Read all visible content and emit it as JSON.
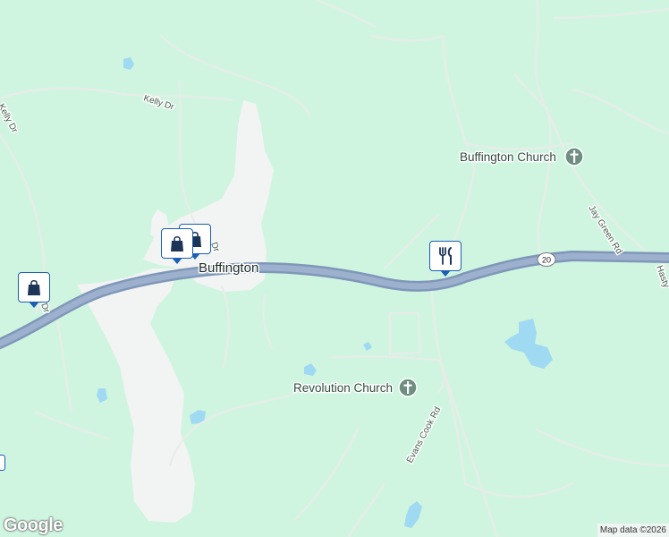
{
  "map": {
    "colors": {
      "land": "#cff5e0",
      "urban": "#f2f3f3",
      "water": "#9fd9f2",
      "highway": "#8fa7c7",
      "minor_road": "#e8ece9",
      "pin_border": "#1a5fb4",
      "pin_icon": "#1d3557"
    },
    "town": "Buffington",
    "places": [
      {
        "label": "Buffington Church",
        "icon": "church-icon"
      },
      {
        "label": "Revolution Church",
        "icon": "church-icon"
      }
    ],
    "roads": {
      "kelly_dr": "Kelly Dr",
      "kelly_dr_west": "Kelly Dr",
      "jay_green_rd": "Jay Green Rd",
      "evans_cook_rd": "Evans Cook Rd",
      "hasty": "Hasty",
      "buffington_dr": "B",
      "buffington_dr_tail": "Dr",
      "west_dr": "Dr"
    },
    "route_shield": "20",
    "pins": [
      {
        "category": "shopping",
        "icon": "shopping-bag-icon"
      },
      {
        "category": "shopping",
        "icon": "shopping-bag-icon"
      },
      {
        "category": "shopping",
        "icon": "shopping-bag-icon"
      },
      {
        "category": "restaurant",
        "icon": "fork-knife-icon"
      }
    ],
    "attribution": "Map data ©2026",
    "logo": "Google"
  }
}
